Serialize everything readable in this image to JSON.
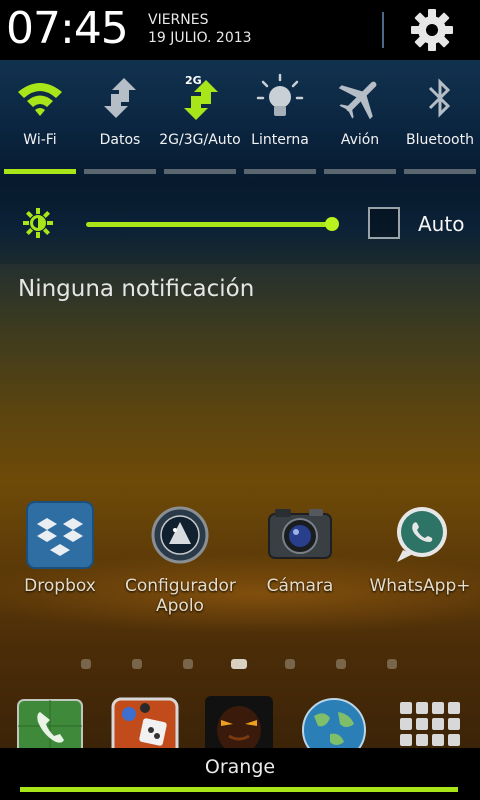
{
  "status": {
    "time": "07:45",
    "day": "VIERNES",
    "date": "19 JULIO. 2013"
  },
  "toggles": [
    {
      "label": "Wi-Fi",
      "icon": "wifi-icon",
      "on": true
    },
    {
      "label": "Datos",
      "icon": "data-arrows-icon",
      "on": false
    },
    {
      "label": "2G/3G/Auto",
      "icon": "network-mode-icon",
      "badge": "2G",
      "on": true
    },
    {
      "label": "Linterna",
      "icon": "flashlight-icon",
      "on": false
    },
    {
      "label": "Avión",
      "icon": "airplane-icon",
      "on": false
    },
    {
      "label": "Bluetooth",
      "icon": "bluetooth-icon",
      "on": false
    }
  ],
  "brightness": {
    "level": 1.0,
    "auto_label": "Auto",
    "auto_checked": false
  },
  "notifications": {
    "empty_text": "Ninguna notificación"
  },
  "home_apps": [
    {
      "name": "Dropbox",
      "icon": "dropbox-icon"
    },
    {
      "name": "Configurador Apolo",
      "icon": "apolo-icon"
    },
    {
      "name": "Cámara",
      "icon": "camera-icon"
    },
    {
      "name": "WhatsApp+",
      "icon": "whatsapp-icon"
    }
  ],
  "page_indicator": {
    "count": 7,
    "active": 3
  },
  "dock": [
    {
      "icon": "phone-icon"
    },
    {
      "icon": "game-icon"
    },
    {
      "icon": "face-icon"
    },
    {
      "icon": "browser-globe-icon"
    },
    {
      "icon": "app-drawer-icon"
    }
  ],
  "carrier": "Orange",
  "colors": {
    "accent": "#a8e619",
    "inactive_bar": "#5b6670",
    "panel": "#0b2540"
  }
}
